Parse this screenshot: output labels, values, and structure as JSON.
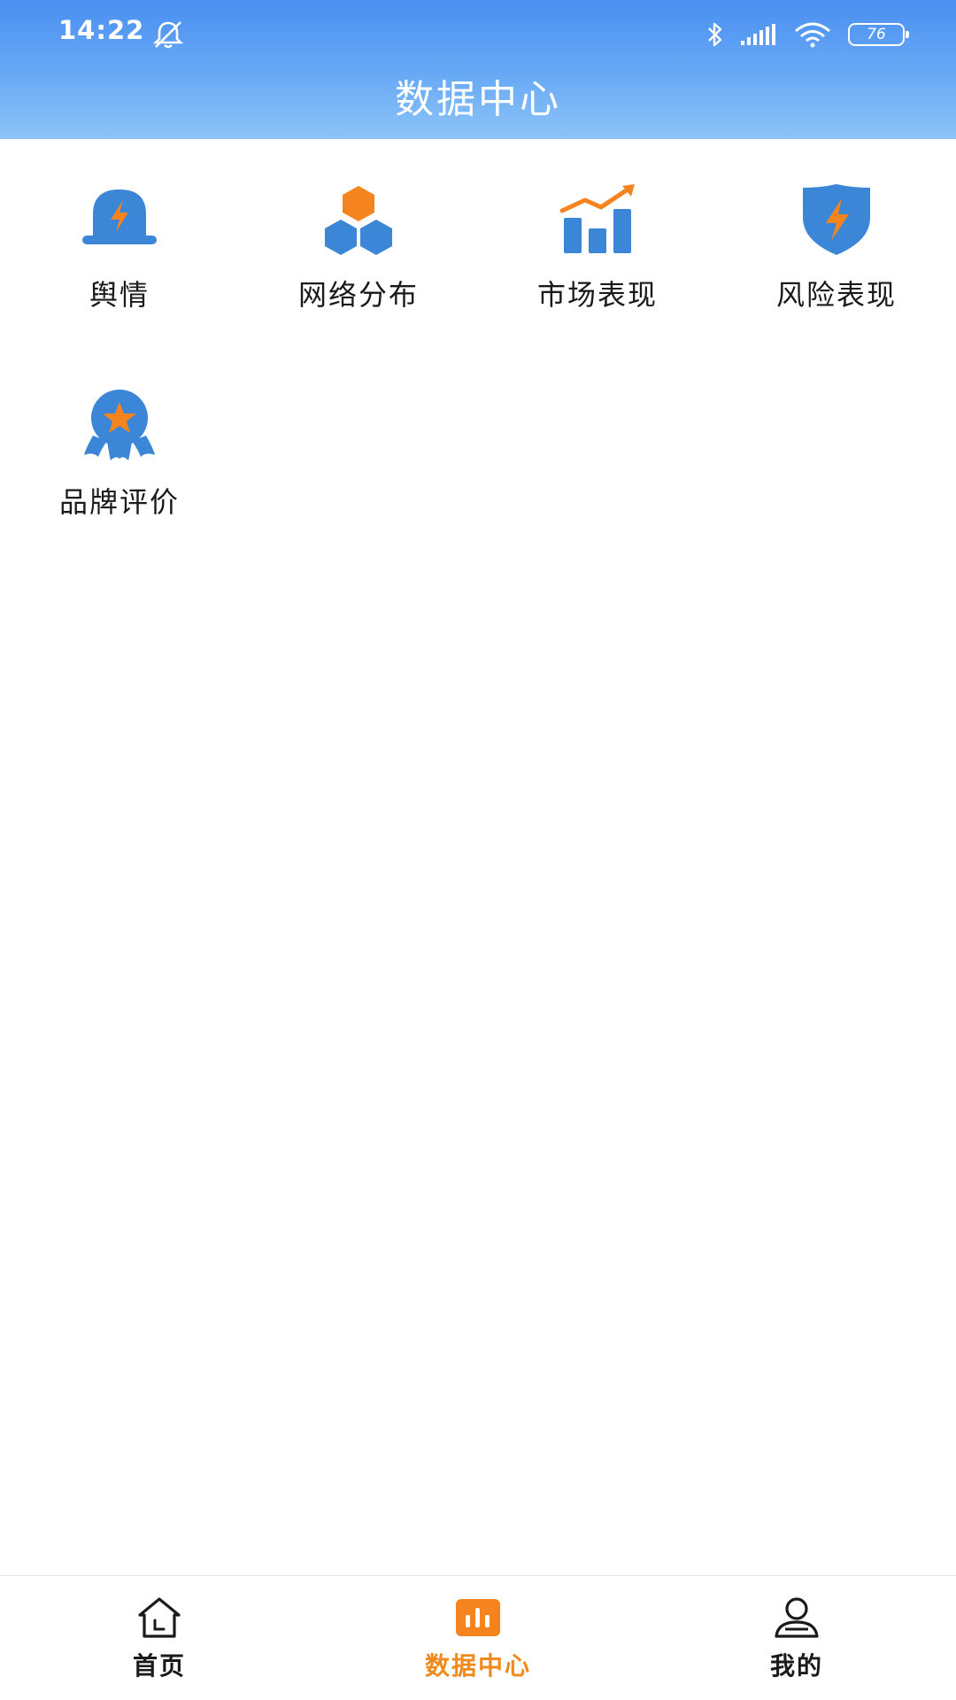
{
  "status_bar": {
    "time": "14:22",
    "battery": "76",
    "icons": [
      "silent-icon",
      "bluetooth-icon",
      "signal-icon",
      "wifi-icon",
      "battery-icon"
    ]
  },
  "header": {
    "title": "数据中心"
  },
  "grid": {
    "items": [
      {
        "label": "舆情",
        "icon": "alarm-light-icon"
      },
      {
        "label": "网络分布",
        "icon": "cubes-icon"
      },
      {
        "label": "市场表现",
        "icon": "bar-chart-trend-icon"
      },
      {
        "label": "风险表现",
        "icon": "shield-bolt-icon"
      },
      {
        "label": "品牌评价",
        "icon": "award-badge-icon"
      }
    ]
  },
  "tabbar": {
    "tabs": [
      {
        "label": "首页",
        "icon": "home-icon",
        "active": false
      },
      {
        "label": "数据中心",
        "icon": "data-chart-icon",
        "active": true
      },
      {
        "label": "我的",
        "icon": "user-icon",
        "active": false
      }
    ]
  },
  "colors": {
    "header_top": "#4a8ff2",
    "header_bottom": "#8ec4f8",
    "icon_blue": "#3b86d6",
    "icon_orange": "#f5841f",
    "active_tab": "#f08a1c"
  }
}
